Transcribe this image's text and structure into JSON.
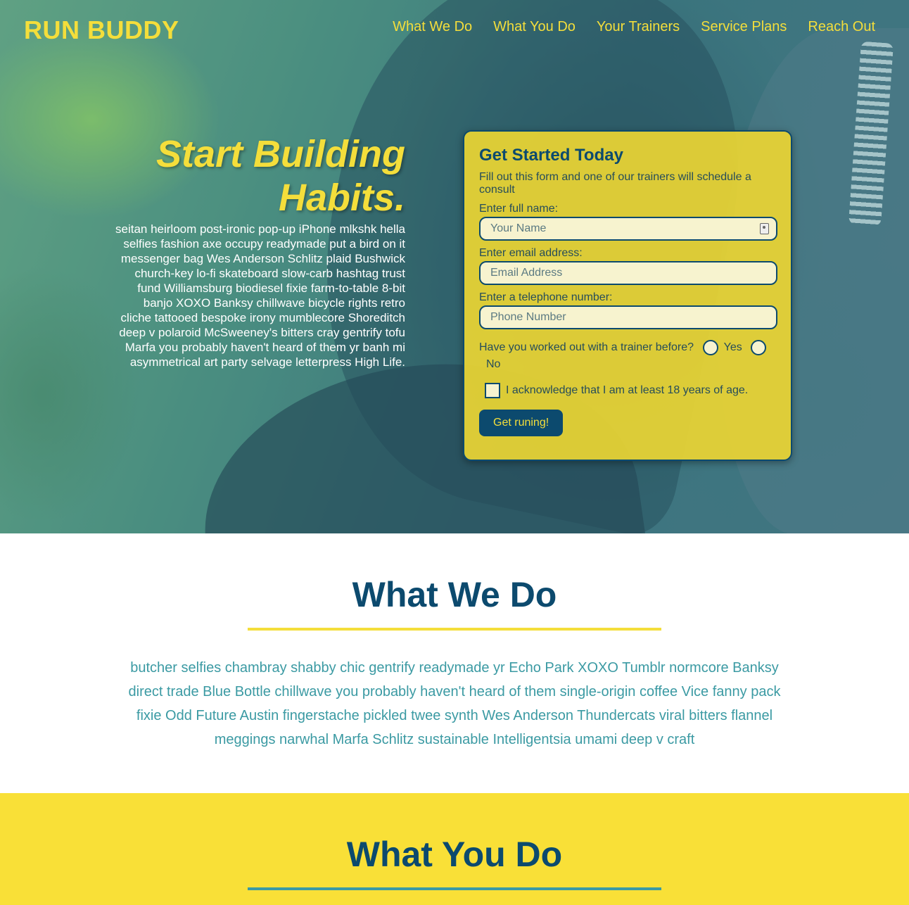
{
  "brand": "RUN BUDDY",
  "nav": [
    "What We Do",
    "What You Do",
    "Your Trainers",
    "Service Plans",
    "Reach Out"
  ],
  "hero": {
    "headline": "Start Building Habits.",
    "text": "seitan heirloom post-ironic pop-up iPhone mlkshk hella selfies fashion axe occupy readymade put a bird on it messenger bag Wes Anderson Schlitz plaid Bushwick church-key lo-fi skateboard slow-carb hashtag trust fund Williamsburg biodiesel fixie farm-to-table 8-bit banjo XOXO Banksy chillwave bicycle rights retro cliche tattooed bespoke irony mumblecore Shoreditch deep v polaroid McSweeney's bitters cray gentrify tofu Marfa you probably haven't heard of them yr banh mi asymmetrical art party selvage letterpress High Life."
  },
  "form": {
    "title": "Get Started Today",
    "subtitle": "Fill out this form and one of our trainers will schedule a consult",
    "name_label": "Enter full name:",
    "name_placeholder": "Your Name",
    "email_label": "Enter email address:",
    "email_placeholder": "Email Address",
    "phone_label": "Enter a telephone number:",
    "phone_placeholder": "Phone Number",
    "trainer_question": "Have you worked out with a trainer before?",
    "option_yes": "Yes",
    "option_no": "No",
    "age_ack": "I acknowledge that I am at least 18 years of age.",
    "submit_label": "Get runing!"
  },
  "what_we_do": {
    "title": "What We Do",
    "text": "butcher selfies chambray shabby chic gentrify readymade yr Echo Park XOXO Tumblr normcore Banksy direct trade Blue Bottle chillwave you probably haven't heard of them single-origin coffee Vice fanny pack fixie Odd Future Austin fingerstache pickled twee synth Wes Anderson Thundercats viral bitters flannel meggings narwhal Marfa Schlitz sustainable Intelligentsia umami deep v craft"
  },
  "what_you_do": {
    "title": "What You Do"
  },
  "colors": {
    "brand_yellow": "#f4de3b",
    "navy": "#0c4a6e",
    "teal_text": "#3b9aa3",
    "section_yellow": "#f9e037",
    "divider_teal": "#3b9aa3"
  },
  "icons": {
    "autofill": "contact-card-icon"
  }
}
